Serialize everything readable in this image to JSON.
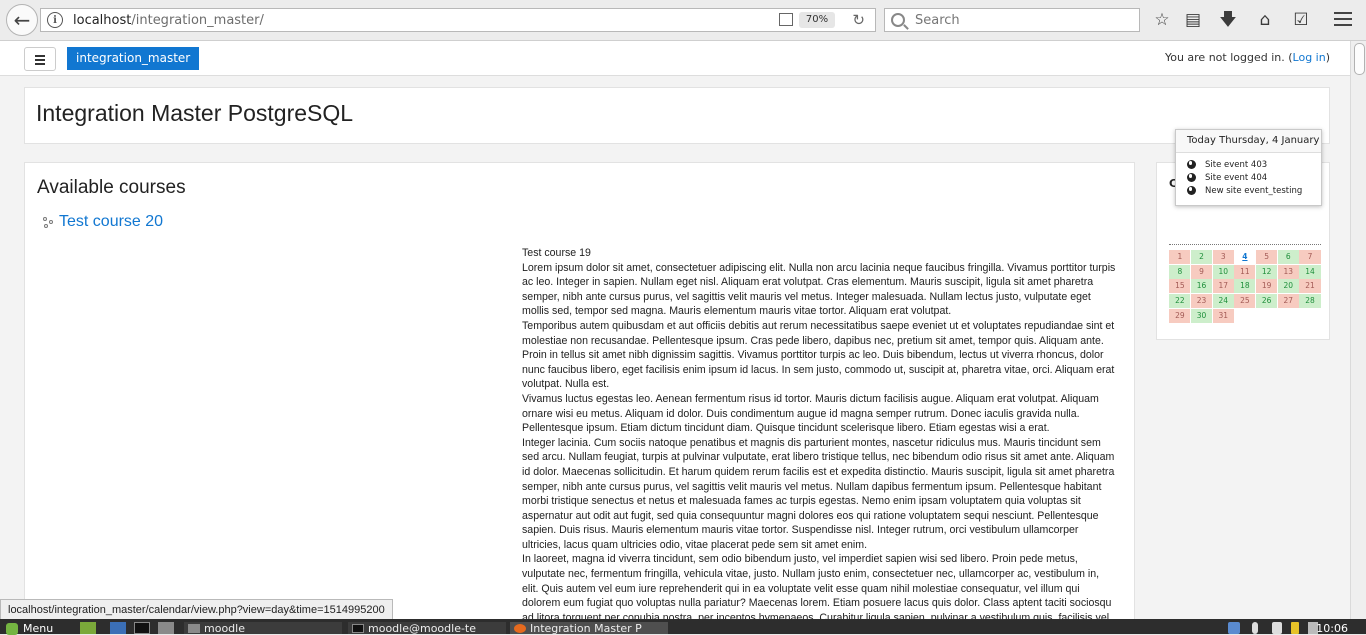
{
  "browser": {
    "url_host": "localhost",
    "url_path": "/integration_master/",
    "zoom": "70%",
    "search_placeholder": "Search",
    "status_url": "localhost/integration_master/calendar/view.php?view=day&time=1514995200"
  },
  "nav": {
    "brand": "integration_master",
    "login_text": "You are not logged in. (",
    "login_link": "Log in",
    "login_close": ")"
  },
  "header": {
    "title": "Integration Master PostgreSQL"
  },
  "main": {
    "section_title": "Available courses",
    "course_link": "Test course 20",
    "summary_title": "Test course 19",
    "paragraphs": [
      "Lorem ipsum dolor sit amet, consectetuer adipiscing elit. Nulla non arcu lacinia neque faucibus fringilla. Vivamus porttitor turpis ac leo. Integer in sapien. Nullam eget nisl. Aliquam erat volutpat. Cras elementum. Mauris suscipit, ligula sit amet pharetra semper, nibh ante cursus purus, vel sagittis velit mauris vel metus. Integer malesuada. Nullam lectus justo, vulputate eget mollis sed, tempor sed magna. Mauris elementum mauris vitae tortor. Aliquam erat volutpat.",
      "Temporibus autem quibusdam et aut officiis debitis aut rerum necessitatibus saepe eveniet ut et voluptates repudiandae sint et molestiae non recusandae. Pellentesque ipsum. Cras pede libero, dapibus nec, pretium sit amet, tempor quis. Aliquam ante. Proin in tellus sit amet nibh dignissim sagittis. Vivamus porttitor turpis ac leo. Duis bibendum, lectus ut viverra rhoncus, dolor nunc faucibus libero, eget facilisis enim ipsum id lacus. In sem justo, commodo ut, suscipit at, pharetra vitae, orci. Aliquam erat volutpat. Nulla est.",
      "Vivamus luctus egestas leo. Aenean fermentum risus id tortor. Mauris dictum facilisis augue. Aliquam erat volutpat. Aliquam ornare wisi eu metus. Aliquam id dolor. Duis condimentum augue id magna semper rutrum. Donec iaculis gravida nulla. Pellentesque ipsum. Etiam dictum tincidunt diam. Quisque tincidunt scelerisque libero. Etiam egestas wisi a erat.",
      "Integer lacinia. Cum sociis natoque penatibus et magnis dis parturient montes, nascetur ridiculus mus. Mauris tincidunt sem sed arcu. Nullam feugiat, turpis at pulvinar vulputate, erat libero tristique tellus, nec bibendum odio risus sit amet ante. Aliquam id dolor. Maecenas sollicitudin. Et harum quidem rerum facilis est et expedita distinctio. Mauris suscipit, ligula sit amet pharetra semper, nibh ante cursus purus, vel sagittis velit mauris vel metus. Nullam dapibus fermentum ipsum. Pellentesque habitant morbi tristique senectus et netus et malesuada fames ac turpis egestas. Nemo enim ipsam voluptatem quia voluptas sit aspernatur aut odit aut fugit, sed quia consequuntur magni dolores eos qui ratione voluptatem sequi nesciunt. Pellentesque sapien. Duis risus. Mauris elementum mauris vitae tortor. Suspendisse nisl. Integer rutrum, orci vestibulum ullamcorper ultricies, lacus quam ultricies odio, vitae placerat pede sem sit amet enim.",
      "In laoreet, magna id viverra tincidunt, sem odio bibendum justo, vel imperdiet sapien wisi sed libero. Proin pede metus, vulputate nec, fermentum fringilla, vehicula vitae, justo. Nullam justo enim, consectetuer nec, ullamcorper ac, vestibulum in, elit. Quis autem vel eum iure reprehenderit qui in ea voluptate velit esse quam nihil molestiae consequatur, vel illum qui dolorem eum fugiat quo voluptas nulla pariatur? Maecenas lorem. Etiam posuere lacus quis dolor. Class aptent taciti sociosqu ad litora torquent per conubia nostra, per inceptos hymenaeos. Curabitur ligula sapien, pulvinar a vestibulum quis, facilisis vel sapien."
    ]
  },
  "calendar": {
    "block_letter": "C",
    "popup_title": "Today Thursday, 4 January",
    "events": [
      "Site event 403",
      "Site event 404",
      "New site event_testing"
    ],
    "days": [
      {
        "d": "1",
        "c": "pink"
      },
      {
        "d": "2",
        "c": "green"
      },
      {
        "d": "3",
        "c": "pink"
      },
      {
        "d": "4",
        "c": "today"
      },
      {
        "d": "5",
        "c": "pink"
      },
      {
        "d": "6",
        "c": "green"
      },
      {
        "d": "7",
        "c": "pink"
      },
      {
        "d": "8",
        "c": "green"
      },
      {
        "d": "9",
        "c": "pink"
      },
      {
        "d": "10",
        "c": "green"
      },
      {
        "d": "11",
        "c": "pink"
      },
      {
        "d": "12",
        "c": "green"
      },
      {
        "d": "13",
        "c": "pink"
      },
      {
        "d": "14",
        "c": "green"
      },
      {
        "d": "15",
        "c": "pink"
      },
      {
        "d": "16",
        "c": "green"
      },
      {
        "d": "17",
        "c": "pink"
      },
      {
        "d": "18",
        "c": "green"
      },
      {
        "d": "19",
        "c": "pink"
      },
      {
        "d": "20",
        "c": "green"
      },
      {
        "d": "21",
        "c": "pink"
      },
      {
        "d": "22",
        "c": "green"
      },
      {
        "d": "23",
        "c": "pink"
      },
      {
        "d": "24",
        "c": "green"
      },
      {
        "d": "25",
        "c": "pink"
      },
      {
        "d": "26",
        "c": "green"
      },
      {
        "d": "27",
        "c": "pink"
      },
      {
        "d": "28",
        "c": "green"
      },
      {
        "d": "29",
        "c": "pink"
      },
      {
        "d": "30",
        "c": "green"
      },
      {
        "d": "31",
        "c": "pink"
      }
    ]
  },
  "taskbar": {
    "menu_label": "Menu",
    "tasks": [
      {
        "label": "moodle",
        "active": false
      },
      {
        "label": "moodle@moodle-te",
        "active": false
      },
      {
        "label": "Integration Master P",
        "active": true
      }
    ],
    "clock": "10:06"
  },
  "colors": {
    "accent": "#1177d1",
    "cal_pink": "#f7cbc0",
    "cal_green": "#cdeecb"
  }
}
